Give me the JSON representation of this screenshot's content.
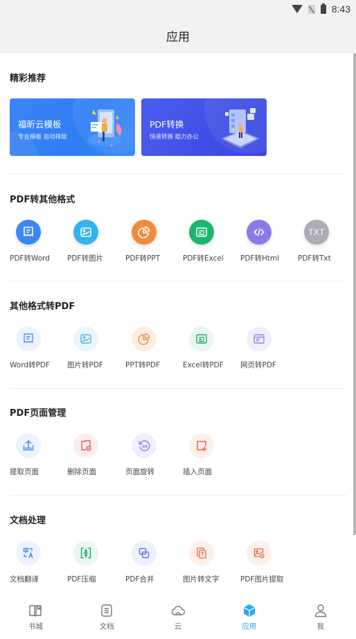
{
  "status_bar": {
    "time": "8:43",
    "icons": [
      "wifi-icon",
      "no-sim-icon",
      "battery-icon"
    ]
  },
  "header": {
    "title": "应用"
  },
  "sections": {
    "featured": {
      "title": "精彩推荐",
      "banners": [
        {
          "title": "福昕云模板",
          "subtitle": "专业模板  自动排版",
          "color": "#3183f6"
        },
        {
          "title": "PDF转换",
          "subtitle": "快速转换  助力办公",
          "color": "#4352ea"
        }
      ]
    },
    "pdf_to_other": {
      "title": "PDF转其他格式",
      "items": [
        {
          "label": "PDF转Word",
          "icon": "word-doc-icon",
          "color": "#3d86f6"
        },
        {
          "label": "PDF转图片",
          "icon": "image-icon",
          "color": "#34b3ee"
        },
        {
          "label": "PDF转PPT",
          "icon": "pie-chart-icon",
          "color": "#f28a3c"
        },
        {
          "label": "PDF转Excel",
          "icon": "sheet-icon",
          "color": "#1bb56d"
        },
        {
          "label": "PDF转Html",
          "icon": "code-icon",
          "color": "#8e79e8"
        },
        {
          "label": "PDF转Txt",
          "icon": "txt-icon",
          "icon_text": "TXT",
          "color": "#aeaab6"
        }
      ]
    },
    "other_to_pdf": {
      "title": "其他格式转PDF",
      "items": [
        {
          "label": "Word转PDF",
          "icon": "word-doc-icon",
          "color": "#4b8cf3"
        },
        {
          "label": "图片转PDF",
          "icon": "image-icon",
          "color": "#3eb0e6"
        },
        {
          "label": "PPT转PDF",
          "icon": "pie-chart-icon",
          "color": "#ef8b47"
        },
        {
          "label": "Excel转PDF",
          "icon": "sheet-icon",
          "color": "#23a86a"
        },
        {
          "label": "网页转PDF",
          "icon": "webpage-icon",
          "color": "#9a83e6"
        }
      ]
    },
    "page_management": {
      "title": "PDF页面管理",
      "items": [
        {
          "label": "提取页面",
          "icon": "extract-upload-icon",
          "color": "#4b8cf3"
        },
        {
          "label": "删除页面",
          "icon": "delete-page-icon",
          "color": "#e5575a"
        },
        {
          "label": "页面旋转",
          "icon": "rotate-90-icon",
          "color": "#8d7ae6"
        },
        {
          "label": "插入页面",
          "icon": "insert-page-icon",
          "color": "#e8694a"
        }
      ]
    },
    "doc_processing": {
      "title": "文档处理",
      "items": [
        {
          "label": "文档翻译",
          "icon": "translate-icon",
          "color": "#4b8cf3"
        },
        {
          "label": "PDF压缩",
          "icon": "compress-icon",
          "color": "#22a96a"
        },
        {
          "label": "PDF合并",
          "icon": "merge-icon",
          "color": "#5b7ae8"
        },
        {
          "label": "图片转文字",
          "icon": "image-to-text-icon",
          "color": "#e8694a"
        },
        {
          "label": "PDF图片提取",
          "icon": "image-extract-icon",
          "color": "#e8694a"
        }
      ]
    }
  },
  "bottom_nav": {
    "items": [
      {
        "label": "书城",
        "icon": "book-icon",
        "active": false
      },
      {
        "label": "文档",
        "icon": "document-icon",
        "active": false
      },
      {
        "label": "云",
        "icon": "cloud-icon",
        "active": false
      },
      {
        "label": "应用",
        "icon": "apps-cube-icon",
        "active": true
      },
      {
        "label": "我",
        "icon": "user-icon",
        "active": false
      }
    ],
    "active_color": "#2aa7f0"
  }
}
